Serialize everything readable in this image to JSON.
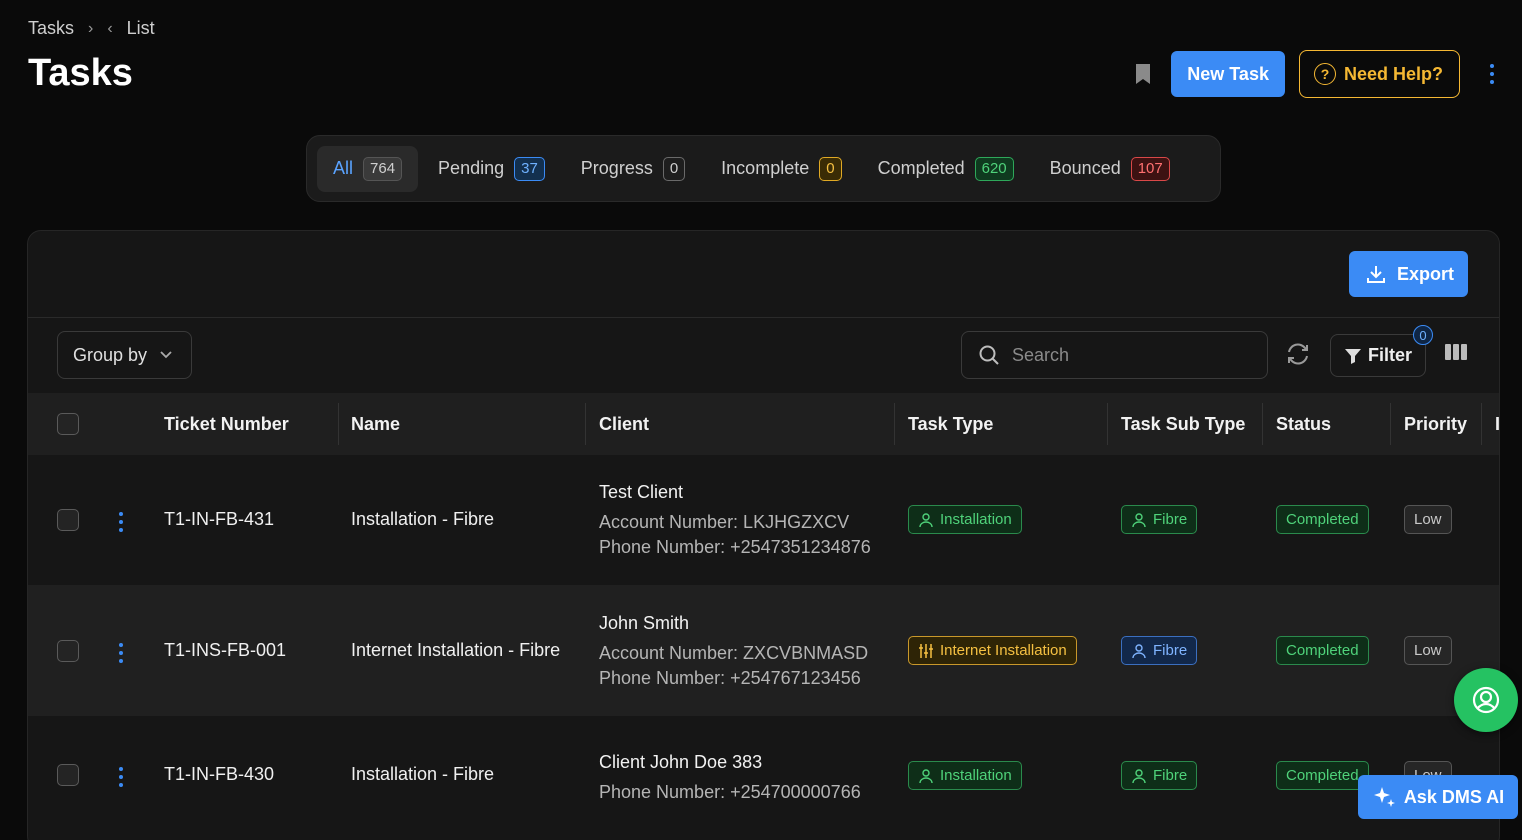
{
  "breadcrumb": {
    "root": "Tasks",
    "current": "List"
  },
  "page_title": "Tasks",
  "top_actions": {
    "new_task": "New Task",
    "need_help": "Need Help?"
  },
  "tabs": [
    {
      "label": "All",
      "count": "764"
    },
    {
      "label": "Pending",
      "count": "37"
    },
    {
      "label": "Progress",
      "count": "0"
    },
    {
      "label": "Incomplete",
      "count": "0"
    },
    {
      "label": "Completed",
      "count": "620"
    },
    {
      "label": "Bounced",
      "count": "107"
    }
  ],
  "toolbar": {
    "export": "Export",
    "group_by": "Group by",
    "search_placeholder": "Search",
    "filter": "Filter",
    "filter_count": "0"
  },
  "table": {
    "headers": [
      "Ticket Number",
      "Name",
      "Client",
      "Task Type",
      "Task Sub Type",
      "Status",
      "Priority",
      "I"
    ],
    "rows": [
      {
        "ticket": "T1-IN-FB-431",
        "name": "Installation - Fibre",
        "client_name": "Test Client",
        "account": "Account Number: LKJHGZXCV",
        "phone": "Phone Number: +2547351234876",
        "task_type": "Installation",
        "sub_type": "Fibre",
        "status": "Completed",
        "priority": "Low"
      },
      {
        "ticket": "T1-INS-FB-001",
        "name": "Internet Installation - Fibre",
        "client_name": "John Smith",
        "account": "Account Number: ZXCVBNMASD",
        "phone": "Phone Number: +254767123456",
        "task_type": "Internet Installation",
        "sub_type": "Fibre",
        "status": "Completed",
        "priority": "Low"
      },
      {
        "ticket": "T1-IN-FB-430",
        "name": "Installation - Fibre",
        "client_name": "Client John Doe 383",
        "phone": "Phone Number: +254700000766",
        "task_type": "Installation",
        "sub_type": "Fibre",
        "status": "Completed",
        "priority": "Low"
      }
    ]
  },
  "ask_ai": "Ask DMS AI",
  "colors": {
    "accent": "#3b8bf5",
    "help": "#f5b833",
    "success": "#25c262"
  }
}
